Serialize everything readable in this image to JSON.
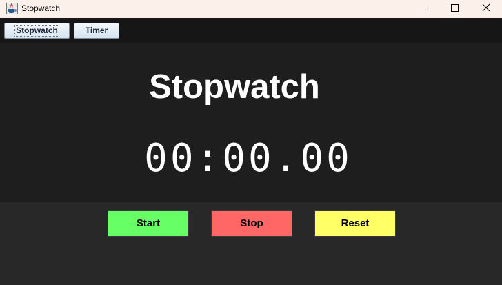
{
  "window": {
    "title": "Stopwatch",
    "icon": "java-cup-icon",
    "controls": [
      "minimize-icon",
      "maximize-icon",
      "close-icon"
    ]
  },
  "tabs": [
    {
      "label": "Stopwatch",
      "selected": true
    },
    {
      "label": "Timer",
      "selected": false
    }
  ],
  "display": {
    "heading": "Stopwatch",
    "time": "00:00.00"
  },
  "buttons": {
    "start": {
      "label": "Start",
      "color": "#66ff66"
    },
    "stop": {
      "label": "Stop",
      "color": "#ff6666"
    },
    "reset": {
      "label": "Reset",
      "color": "#ffff66"
    }
  },
  "colors": {
    "title_bar": "#fbf0ea",
    "tab_bar": "#161616",
    "display_bg": "#1e1e1e",
    "controls_bg": "#282828",
    "text": "#ffffff"
  }
}
